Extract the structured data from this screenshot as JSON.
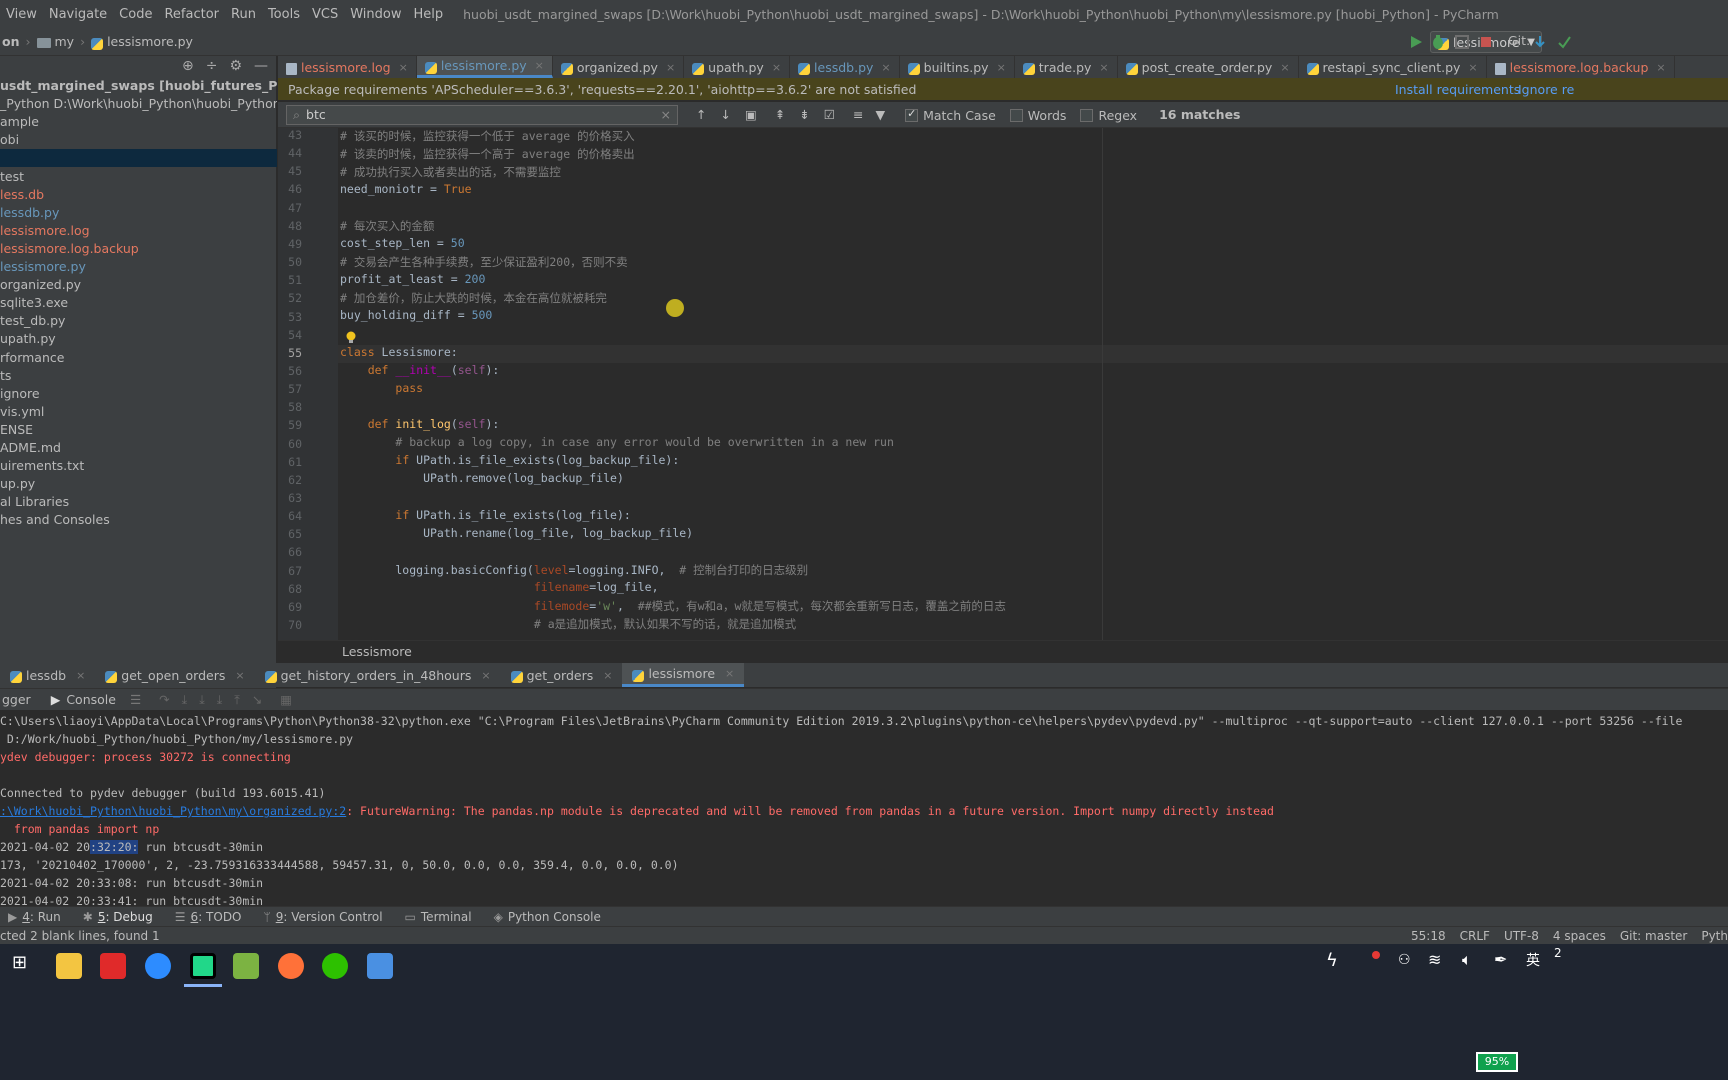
{
  "menubar": {
    "items": [
      "View",
      "Navigate",
      "Code",
      "Refactor",
      "Run",
      "Tools",
      "VCS",
      "Window",
      "Help"
    ],
    "window_title": "huobi_usdt_margined_swaps [D:\\Work\\huobi_Python\\huobi_usdt_margined_swaps] - D:\\Work\\huobi_Python\\huobi_Python\\my\\lessismore.py [huobi_Python] - PyCharm"
  },
  "navbar": {
    "crumbs": [
      "on",
      "my",
      "lessismore.py"
    ],
    "run_config": "lessismore",
    "git_label": "Git:"
  },
  "project": {
    "rows": [
      {
        "text": "usdt_margined_swaps [huobi_futures_Python] D:\\",
        "color": "#bbbbbb",
        "bold": true
      },
      {
        "text": "_Python  D:\\Work\\huobi_Python\\huobi_Python",
        "color": "#bbbbbb",
        "bold": false
      },
      {
        "text": "ample",
        "color": "#bbbbbb",
        "bold": false
      },
      {
        "text": "obi",
        "color": "#bbbbbb",
        "bold": false
      },
      {
        "text": "",
        "color": "#bbbbbb",
        "bold": false
      },
      {
        "text": "test",
        "color": "#bbbbbb",
        "bold": false
      },
      {
        "text": "less.db",
        "color": "#e57860",
        "bold": false
      },
      {
        "text": "lessdb.py",
        "color": "#6897bb",
        "bold": false
      },
      {
        "text": "lessismore.log",
        "color": "#e57860",
        "bold": false
      },
      {
        "text": "lessismore.log.backup",
        "color": "#e57860",
        "bold": false
      },
      {
        "text": "lessismore.py",
        "color": "#6897bb",
        "bold": false
      },
      {
        "text": "organized.py",
        "color": "#bbbbbb",
        "bold": false
      },
      {
        "text": "sqlite3.exe",
        "color": "#bbbbbb",
        "bold": false
      },
      {
        "text": "test_db.py",
        "color": "#bbbbbb",
        "bold": false
      },
      {
        "text": "upath.py",
        "color": "#bbbbbb",
        "bold": false
      },
      {
        "text": "rformance",
        "color": "#bbbbbb",
        "bold": false
      },
      {
        "text": "ts",
        "color": "#bbbbbb",
        "bold": false
      },
      {
        "text": "ignore",
        "color": "#bbbbbb",
        "bold": false
      },
      {
        "text": "vis.yml",
        "color": "#bbbbbb",
        "bold": false
      },
      {
        "text": "ENSE",
        "color": "#bbbbbb",
        "bold": false
      },
      {
        "text": "ADME.md",
        "color": "#bbbbbb",
        "bold": false
      },
      {
        "text": "uirements.txt",
        "color": "#bbbbbb",
        "bold": false
      },
      {
        "text": "up.py",
        "color": "#bbbbbb",
        "bold": false
      },
      {
        "text": "al Libraries",
        "color": "#bbbbbb",
        "bold": false
      },
      {
        "text": "hes and Consoles",
        "color": "#bbbbbb",
        "bold": false
      }
    ]
  },
  "tabs": [
    {
      "label": "lessismore.log",
      "color": "#e57860",
      "icon": "log-file-icon"
    },
    {
      "label": "lessismore.py",
      "color": "#6897bb",
      "icon": "python-file-icon"
    },
    {
      "label": "organized.py",
      "color": "#bbbbbb",
      "icon": "python-file-icon"
    },
    {
      "label": "upath.py",
      "color": "#bbbbbb",
      "icon": "python-file-icon"
    },
    {
      "label": "lessdb.py",
      "color": "#6897bb",
      "icon": "python-file-icon"
    },
    {
      "label": "builtins.py",
      "color": "#bbbbbb",
      "icon": "python-file-icon"
    },
    {
      "label": "trade.py",
      "color": "#bbbbbb",
      "icon": "python-file-icon"
    },
    {
      "label": "post_create_order.py",
      "color": "#bbbbbb",
      "icon": "python-file-icon"
    },
    {
      "label": "restapi_sync_client.py",
      "color": "#bbbbbb",
      "icon": "python-file-icon"
    },
    {
      "label": "lessismore.log.backup",
      "color": "#e57860",
      "icon": "log-file-icon"
    }
  ],
  "banner": {
    "text": "Package requirements 'APScheduler==3.6.3', 'requests==2.20.1', 'aiohttp==3.6.2' are not satisfied",
    "install": "Install requirements",
    "ignore": "Ignore re"
  },
  "find": {
    "query": "btc",
    "match_case": "Match Case",
    "words": "Words",
    "regex": "Regex",
    "matches": "16 matches"
  },
  "editor": {
    "line_numbers": [
      "43",
      "44",
      "45",
      "46",
      "47",
      "48",
      "49",
      "50",
      "51",
      "52",
      "53",
      "54",
      "55",
      "56",
      "57",
      "58",
      "59",
      "60",
      "61",
      "62",
      "63",
      "64",
      "65",
      "66",
      "67",
      "68",
      "69",
      "70"
    ],
    "current_line": "55",
    "structure_breadcrumb": "Lessismore"
  },
  "debug": {
    "tabs": [
      "lessdb",
      "get_open_orders",
      "get_history_orders_in_48hours",
      "get_orders",
      "lessismore"
    ],
    "sub_tabs": [
      "gger",
      "Console"
    ],
    "console_lines": [
      {
        "text": "C:\\Users\\liaoyi\\AppData\\Local\\Programs\\Python\\Python38-32\\python.exe \"C:\\Program Files\\JetBrains\\PyCharm Community Edition 2019.3.2\\plugins\\python-ce\\helpers\\pydev\\pydevd.py\" --multiproc --qt-support=auto --client 127.0.0.1 --port 53256 --file",
        "cls": ""
      },
      {
        "text": " D:/Work/huobi_Python/huobi_Python/my/lessismore.py",
        "cls": ""
      },
      {
        "text": "ydev debugger: process 30272 is connecting",
        "cls": "red"
      },
      {
        "text": "",
        "cls": ""
      },
      {
        "text": "Connected to pydev debugger (build 193.6015.41)",
        "cls": ""
      },
      {
        "text": "",
        "cls": ""
      },
      {
        "text": "  from pandas import np",
        "cls": "red"
      },
      {
        "text": "",
        "cls": ""
      },
      {
        "text": "173, '20210402_170000', 2, -23.759316333444588, 59457.31, 0, 50.0, 0.0, 0.0, 359.4, 0.0, 0.0, 0.0)",
        "cls": ""
      },
      {
        "text": "2021-04-02 20:33:08: run btcusdt-30min",
        "cls": ""
      },
      {
        "text": "2021-04-02 20:33:41: run btcusdt-30min",
        "cls": ""
      }
    ],
    "warning_link": ":\\Work\\huobi_Python\\huobi_Python\\my\\organized.py:2",
    "warning_text": ": FutureWarning: The pandas.np module is deprecated and will be removed from pandas in a future version. Import numpy directly instead",
    "run_line_prefix": "2021-04-02 20",
    "run_line_hl": ":32:20:",
    "run_line_suffix": " run btcusdt-30min"
  },
  "tool_windows": [
    {
      "key": "4",
      "label": ": Run",
      "icon": "run-icon"
    },
    {
      "key": "5",
      "label": ": Debug",
      "icon": "debug-icon"
    },
    {
      "key": "6",
      "label": ": TODO",
      "icon": "todo-icon"
    },
    {
      "key": "9",
      "label": ": Version Control",
      "icon": "vcs-icon"
    },
    {
      "key": "",
      "label": "Terminal",
      "icon": "terminal-icon"
    },
    {
      "key": "",
      "label": "Python Console",
      "icon": "python-console-icon"
    }
  ],
  "status": {
    "message": "cted 2 blank lines, found 1",
    "position": "55:18",
    "line_sep": "CRLF",
    "encoding": "UTF-8",
    "indent": "4 spaces",
    "git": "Git: master",
    "py": "Pyth"
  },
  "taskbar": {
    "battery": "95%",
    "ime": "英",
    "clock": "2"
  },
  "colors": {
    "accent": "#4a88c7",
    "bg": "#2b2b2b",
    "panel": "#3c3f41"
  }
}
